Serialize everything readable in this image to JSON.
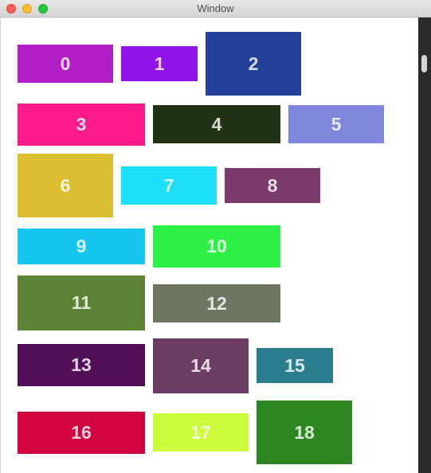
{
  "window": {
    "title": "Window"
  },
  "boxes": [
    {
      "label": "0",
      "color": "#b11fc4"
    },
    {
      "label": "1",
      "color": "#8f15e8"
    },
    {
      "label": "2",
      "color": "#23419b"
    },
    {
      "label": "3",
      "color": "#fb1b8a"
    },
    {
      "label": "4",
      "color": "#203114"
    },
    {
      "label": "5",
      "color": "#7e87d9"
    },
    {
      "label": "6",
      "color": "#dcbe33"
    },
    {
      "label": "7",
      "color": "#1ddffa"
    },
    {
      "label": "8",
      "color": "#7d3b6b"
    },
    {
      "label": "9",
      "color": "#17c6ef"
    },
    {
      "label": "10",
      "color": "#2ff046"
    },
    {
      "label": "11",
      "color": "#5d8337"
    },
    {
      "label": "12",
      "color": "#6c7660"
    },
    {
      "label": "13",
      "color": "#510f57"
    },
    {
      "label": "14",
      "color": "#6c3c62"
    },
    {
      "label": "15",
      "color": "#2b7d8e"
    },
    {
      "label": "16",
      "color": "#d2043f"
    },
    {
      "label": "17",
      "color": "#cdfc3c"
    },
    {
      "label": "18",
      "color": "#2e8622"
    }
  ]
}
